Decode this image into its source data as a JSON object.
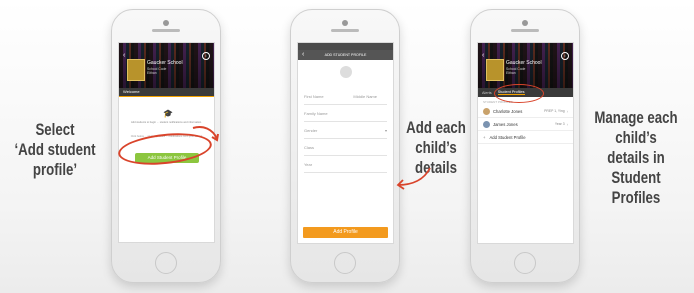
{
  "captions": {
    "left": [
      "Select",
      "‘Add student profile’"
    ],
    "middle": [
      "Add each",
      "child’s details"
    ],
    "right": [
      "Manage each",
      "child’s details in",
      "Student Profiles"
    ]
  },
  "phone1": {
    "school_name": "Gaucker School",
    "school_sub": [
      "School Code",
      "Elthan"
    ],
    "tab": "Welcome",
    "welcome_text": "Add students to begin ... student notifications and information.",
    "note": "Click below ... student profiles ... notifications from your school",
    "add_button": "Add Student Profile"
  },
  "phone2": {
    "header_title": "ADD STUDENT PROFILE",
    "fields": [
      "First Name",
      "Middle Name",
      "Family Name",
      "Gender",
      "Class",
      "Year"
    ],
    "submit_button": "Add Profile"
  },
  "phone3": {
    "school_name": "Gaucker School",
    "school_sub": [
      "School Code",
      "Elthan"
    ],
    "tabs": [
      "Alerts",
      "Student Profiles"
    ],
    "section_label": "STUDENT PROFILES",
    "students": [
      {
        "name": "Charlotte Jones",
        "detail": "PREP 1, Ying"
      },
      {
        "name": "James Jones",
        "detail": "Year 3"
      }
    ],
    "add_link": "Add Student Profile"
  },
  "colors": {
    "accent_green": "#8cc63f",
    "accent_orange": "#f39a1e",
    "annotation_red": "#d9442b"
  }
}
